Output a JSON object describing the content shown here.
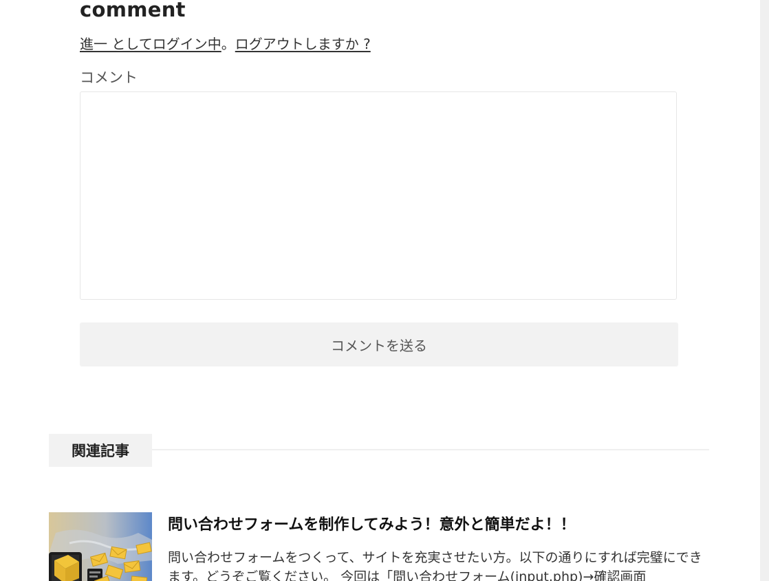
{
  "comment_section": {
    "heading": "comment",
    "logged_in_user_link": "進一 としてログイン中",
    "separator": "。",
    "logout_link": "ログアウトしますか ?",
    "comment_label": "コメント",
    "comment_value": "",
    "submit_label": "コメントを送る"
  },
  "related": {
    "heading": "関連記事",
    "items": [
      {
        "title": "問い合わせフォームを制作してみよう！意外と簡単だよ！！",
        "excerpt": "問い合わせフォームをつくって、サイトを充実させたい方。以下の通りにすれば完璧にできます。どうぞご覧ください。 今回は「問い合わせフォーム(input.php)→確認画面",
        "thumbnail_icon": "mail-envelopes-thumbnail"
      }
    ]
  },
  "colors": {
    "button_bg": "#f2f2f2",
    "heading_box_bg": "#f2f2f2",
    "textarea_border": "#e6e6e6"
  }
}
